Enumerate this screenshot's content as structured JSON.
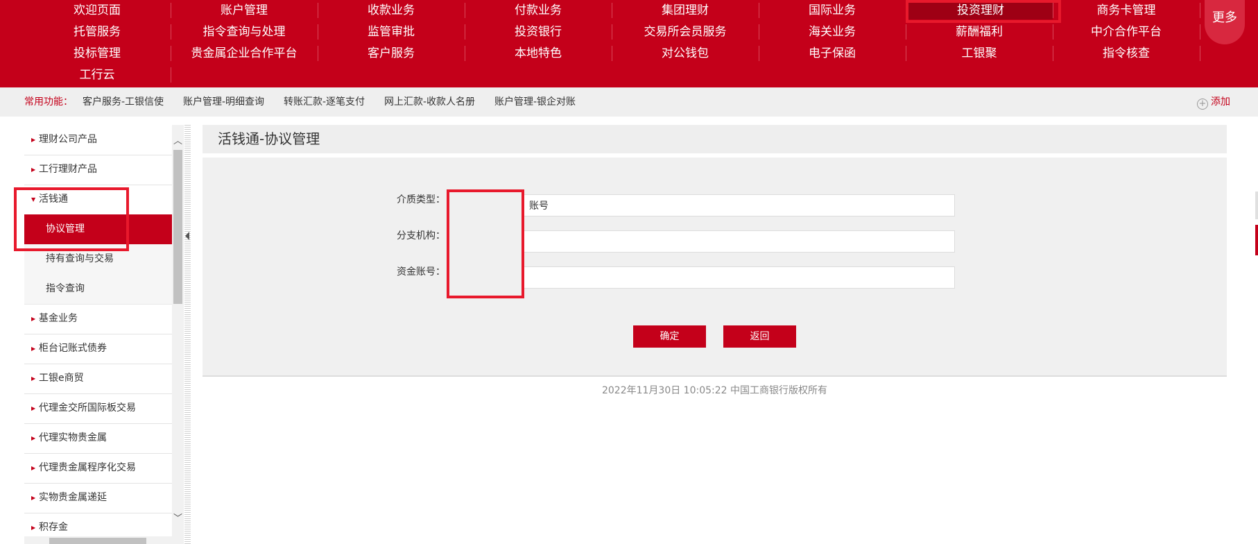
{
  "top_nav": {
    "rows": [
      [
        "欢迎页面",
        "账户管理",
        "收款业务",
        "付款业务",
        "集团理财",
        "国际业务",
        "投资理财",
        "商务卡管理"
      ],
      [
        "托管服务",
        "指令查询与处理",
        "监管审批",
        "投资银行",
        "交易所会员服务",
        "海关业务",
        "薪酬福利",
        "中介合作平台"
      ],
      [
        "投标管理",
        "贵金属企业合作平台",
        "客户服务",
        "本地特色",
        "对公钱包",
        "电子保函",
        "工银聚",
        "指令核查"
      ],
      [
        "工行云"
      ]
    ],
    "active": "投资理财",
    "more_label": "更多"
  },
  "shortcut_bar": {
    "label": "常用功能：",
    "items": [
      "客户服务-工银信使",
      "账户管理-明细查询",
      "转账汇款-逐笔支付",
      "网上汇款-收款人名册",
      "账户管理-银企对账"
    ],
    "add_label": "添加"
  },
  "sidebar": {
    "items": [
      {
        "label": "理财公司产品"
      },
      {
        "label": "工行理财产品"
      },
      {
        "label": "活钱通"
      },
      {
        "label": "协议管理"
      },
      {
        "label": "持有查询与交易"
      },
      {
        "label": "指令查询"
      },
      {
        "label": "基金业务"
      },
      {
        "label": "柜台记账式债券"
      },
      {
        "label": "工银e商贸"
      },
      {
        "label": "代理金交所国际板交易"
      },
      {
        "label": "代理实物贵金属"
      },
      {
        "label": "代理贵金属程序化交易"
      },
      {
        "label": "实物贵金属递延"
      },
      {
        "label": "积存金"
      }
    ]
  },
  "main": {
    "title": "活钱通-协议管理",
    "form": {
      "media_type_label": "介质类型：",
      "media_type_value": "账号",
      "branch_label": "分支机构：",
      "branch_value": "",
      "account_label": "资金账号：",
      "account_value": ""
    },
    "confirm_label": "确定",
    "back_label": "返回",
    "footer": "2022年11月30日 10:05:22   中国工商银行版权所有"
  },
  "colors": {
    "brand_red": "#c4001a",
    "highlight_red": "#e8192c"
  }
}
